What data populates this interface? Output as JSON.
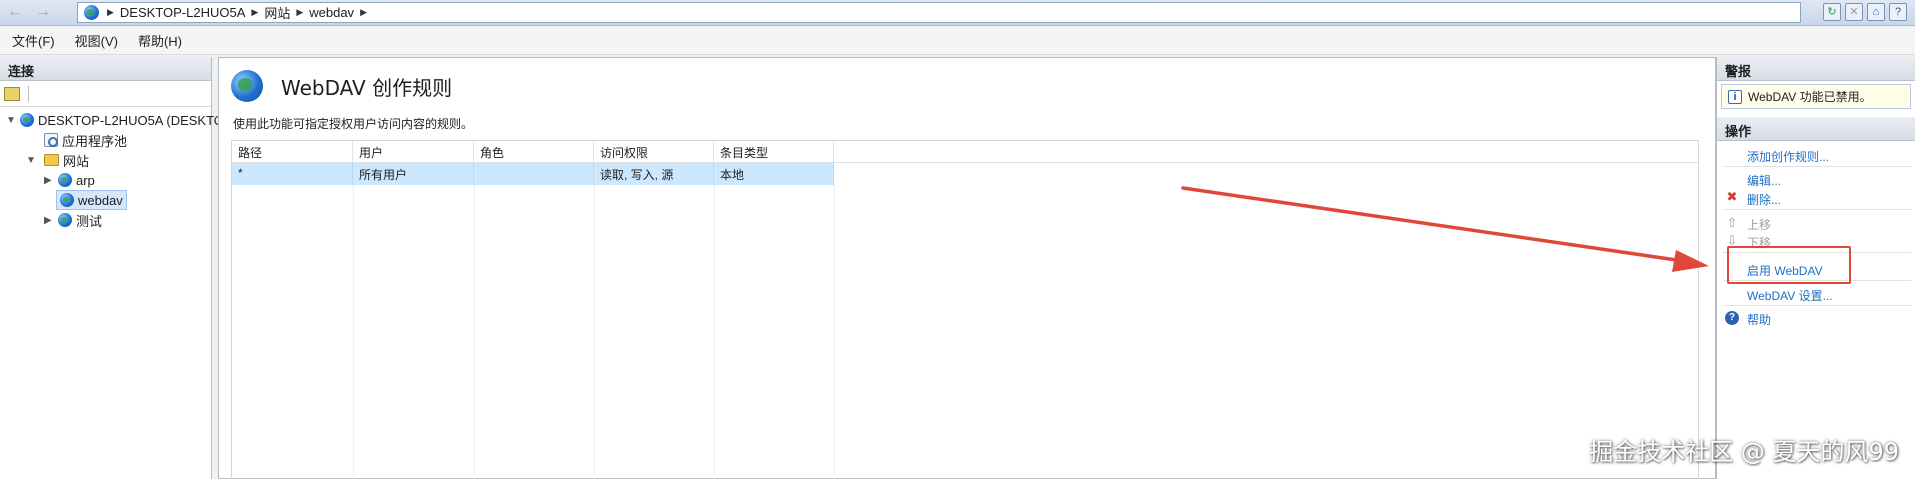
{
  "address_bar": {
    "path": [
      "DESKTOP-L2HUO5A",
      "网站",
      "webdav"
    ]
  },
  "menu": [
    "文件(F)",
    "视图(V)",
    "帮助(H)"
  ],
  "connections": {
    "title": "连接",
    "tree": {
      "server": "DESKTOP-L2HUO5A (DESKTO",
      "app_pools": "应用程序池",
      "sites": "网站",
      "site_items": [
        "arp",
        "webdav",
        "测试"
      ],
      "selected": "webdav"
    }
  },
  "feature": {
    "title": "WebDAV 创作规则",
    "description": "使用此功能可指定授权用户访问内容的规则。",
    "columns": [
      "路径",
      "用户",
      "角色",
      "访问权限",
      "条目类型"
    ],
    "rows": [
      [
        "*",
        "所有用户",
        "",
        "读取, 写入, 源",
        "本地"
      ]
    ]
  },
  "alerts": {
    "title": "警报",
    "message": "WebDAV 功能已禁用。"
  },
  "actions": {
    "title": "操作",
    "add_rule": "添加创作规则...",
    "edit": "编辑...",
    "delete": "删除...",
    "move_up": "上移",
    "move_down": "下移",
    "enable_webdav": "启用 WebDAV",
    "webdav_settings": "WebDAV 设置...",
    "help": "帮助"
  },
  "watermark": "掘金技术社区 @ 夏天的风99",
  "colors": {
    "link": "#1f6fc5",
    "annotation": "#e0473a",
    "selected_row": "#cce8ff"
  }
}
